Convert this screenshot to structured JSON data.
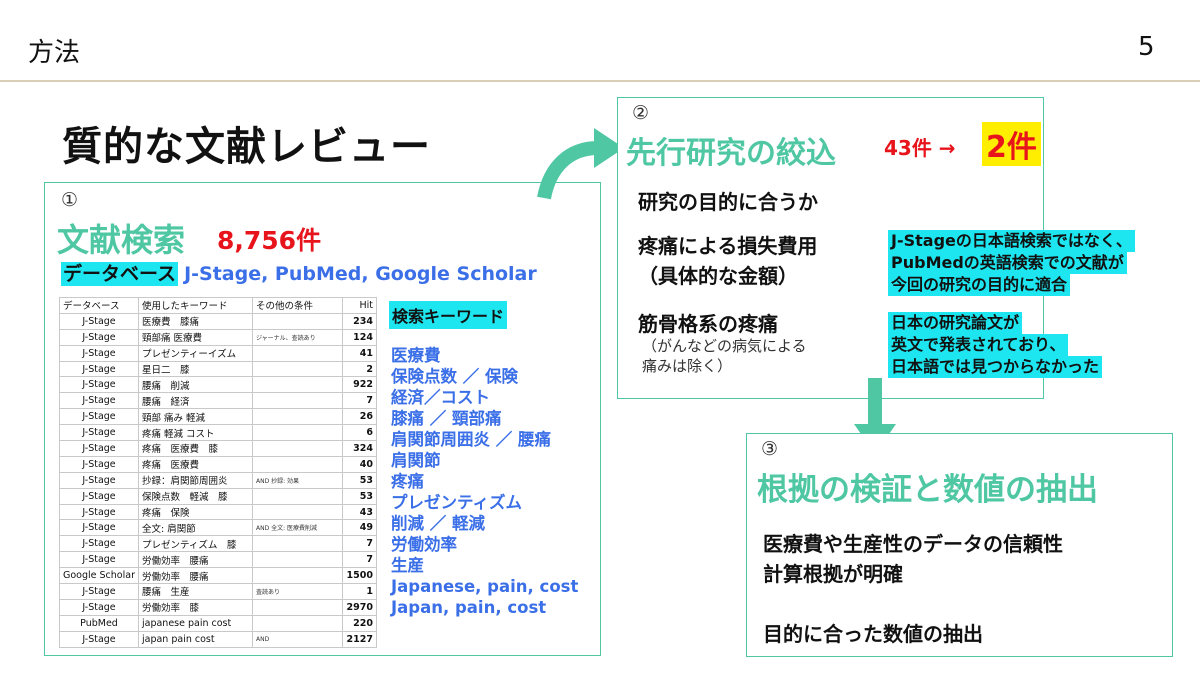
{
  "header": {
    "title": "方法",
    "page_number": "5"
  },
  "main_title": "質的な文献レビュー",
  "section1": {
    "number": "①",
    "title": "文献検索",
    "count": "8,756件",
    "database_label": "データベース",
    "database_values": "J-Stage, PubMed, Google Scholar",
    "table": {
      "headers": [
        "データベース",
        "使用したキーワード",
        "その他の条件",
        "Hit"
      ],
      "rows": [
        [
          "J-Stage",
          "医療費　膝痛",
          "",
          "234"
        ],
        [
          "J-Stage",
          "頸部痛 医療費",
          "ジャーナル、查読あり",
          "124"
        ],
        [
          "J-Stage",
          "プレゼンティーイズム",
          "",
          "41"
        ],
        [
          "J-Stage",
          "星日二　膝",
          "",
          "2"
        ],
        [
          "J-Stage",
          "腰痛　削減",
          "",
          "922"
        ],
        [
          "J-Stage",
          "腰痛　経済",
          "",
          "7"
        ],
        [
          "J-Stage",
          "頸部 痛み 軽減",
          "",
          "26"
        ],
        [
          "J-Stage",
          "疼痛 軽減 コスト",
          "",
          "6"
        ],
        [
          "J-Stage",
          "疼痛　医療費　膝",
          "",
          "324"
        ],
        [
          "J-Stage",
          "疼痛　医療費",
          "",
          "40"
        ],
        [
          "J-Stage",
          "抄録：肩関節周囲炎",
          "AND 抄録: 効果",
          "53"
        ],
        [
          "J-Stage",
          "保険点数　軽減　膝",
          "",
          "53"
        ],
        [
          "J-Stage",
          "疼痛　保険",
          "",
          "43"
        ],
        [
          "J-Stage",
          "全文: 肩関節",
          "AND 全文: 医療費削減",
          "49"
        ],
        [
          "J-Stage",
          "プレゼンティズム　膝",
          "",
          "7"
        ],
        [
          "J-Stage",
          "労働効率　腰痛",
          "",
          "7"
        ],
        [
          "Google Scholar",
          "労働効率　腰痛",
          "",
          "1500"
        ],
        [
          "J-Stage",
          "腰痛　生産",
          "査読あり",
          "1"
        ],
        [
          "J-Stage",
          "労働効率　膝",
          "",
          "2970"
        ],
        [
          "PubMed",
          "japanese pain cost",
          "",
          "220"
        ],
        [
          "J-Stage",
          "japan pain cost",
          "AND",
          "2127"
        ]
      ]
    },
    "keyword_label": "検索キーワード",
    "keywords": [
      "医療費",
      "保険点数 ／ 保険",
      "経済／コスト",
      "膝痛 ／ 頸部痛",
      "肩関節周囲炎 ／ 腰痛",
      "肩関節",
      "疼痛",
      "プレゼンティズム",
      "削減 ／ 軽減",
      "労働効率",
      "生産",
      "Japanese, pain, cost",
      "Japan, pain, cost"
    ]
  },
  "section2": {
    "number": "②",
    "title": "先行研究の絞込",
    "count_from": "43件 →",
    "count_to": "2件",
    "criteria": [
      "研究の目的に合うか",
      "疼痛による損失費用",
      "（具体的な金額）",
      "筋骨格系の疼痛"
    ],
    "criteria_note": [
      "（がんなどの病気による",
      "痛みは除く）"
    ],
    "highlight1": [
      "J-Stageの日本語検索ではなく、",
      "PubMedの英語検索での文献が",
      "今回の研究の目的に適合"
    ],
    "highlight2": [
      "日本の研究論文が",
      "英文で発表されており、",
      "日本語では見つからなかった"
    ]
  },
  "section3": {
    "number": "③",
    "title": "根拠の検証と数値の抽出",
    "lines": [
      "医療費や生産性のデータの信頼性",
      "計算根拠が明確",
      "目的に合った数値の抽出"
    ]
  },
  "colors": {
    "accent": "#4fc7a3",
    "highlight": "#1ee6f0",
    "red": "#e8141c",
    "blue": "#3b6fe8",
    "yellow": "#ffee00"
  }
}
